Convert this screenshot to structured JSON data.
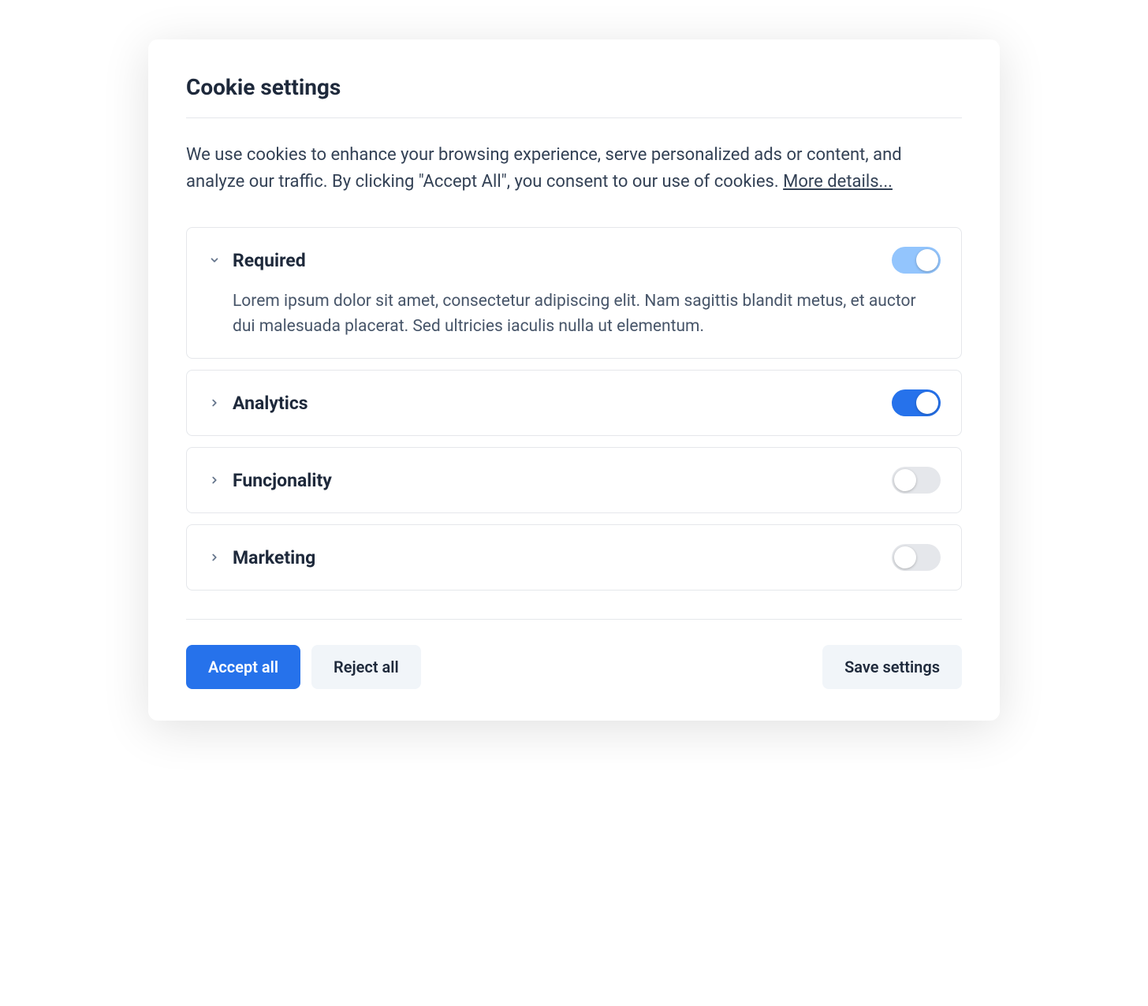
{
  "title": "Cookie settings",
  "description": "We use cookies to enhance your browsing experience, serve personalized ads or content, and analyze our traffic. By clicking \"Accept All\", you consent to our use of cookies. ",
  "more_link": "More details...",
  "categories": [
    {
      "name": "Required",
      "expanded": true,
      "toggle_on": true,
      "toggle_disabled": true,
      "description": "Lorem ipsum dolor sit amet, consectetur adipiscing elit. Nam sagittis blandit metus, et auctor dui malesuada placerat. Sed ultricies iaculis nulla ut elementum."
    },
    {
      "name": "Analytics",
      "expanded": false,
      "toggle_on": true,
      "toggle_disabled": false
    },
    {
      "name": "Funcjonality",
      "expanded": false,
      "toggle_on": false,
      "toggle_disabled": false
    },
    {
      "name": "Marketing",
      "expanded": false,
      "toggle_on": false,
      "toggle_disabled": false
    }
  ],
  "buttons": {
    "accept_all": "Accept all",
    "reject_all": "Reject all",
    "save_settings": "Save settings"
  }
}
